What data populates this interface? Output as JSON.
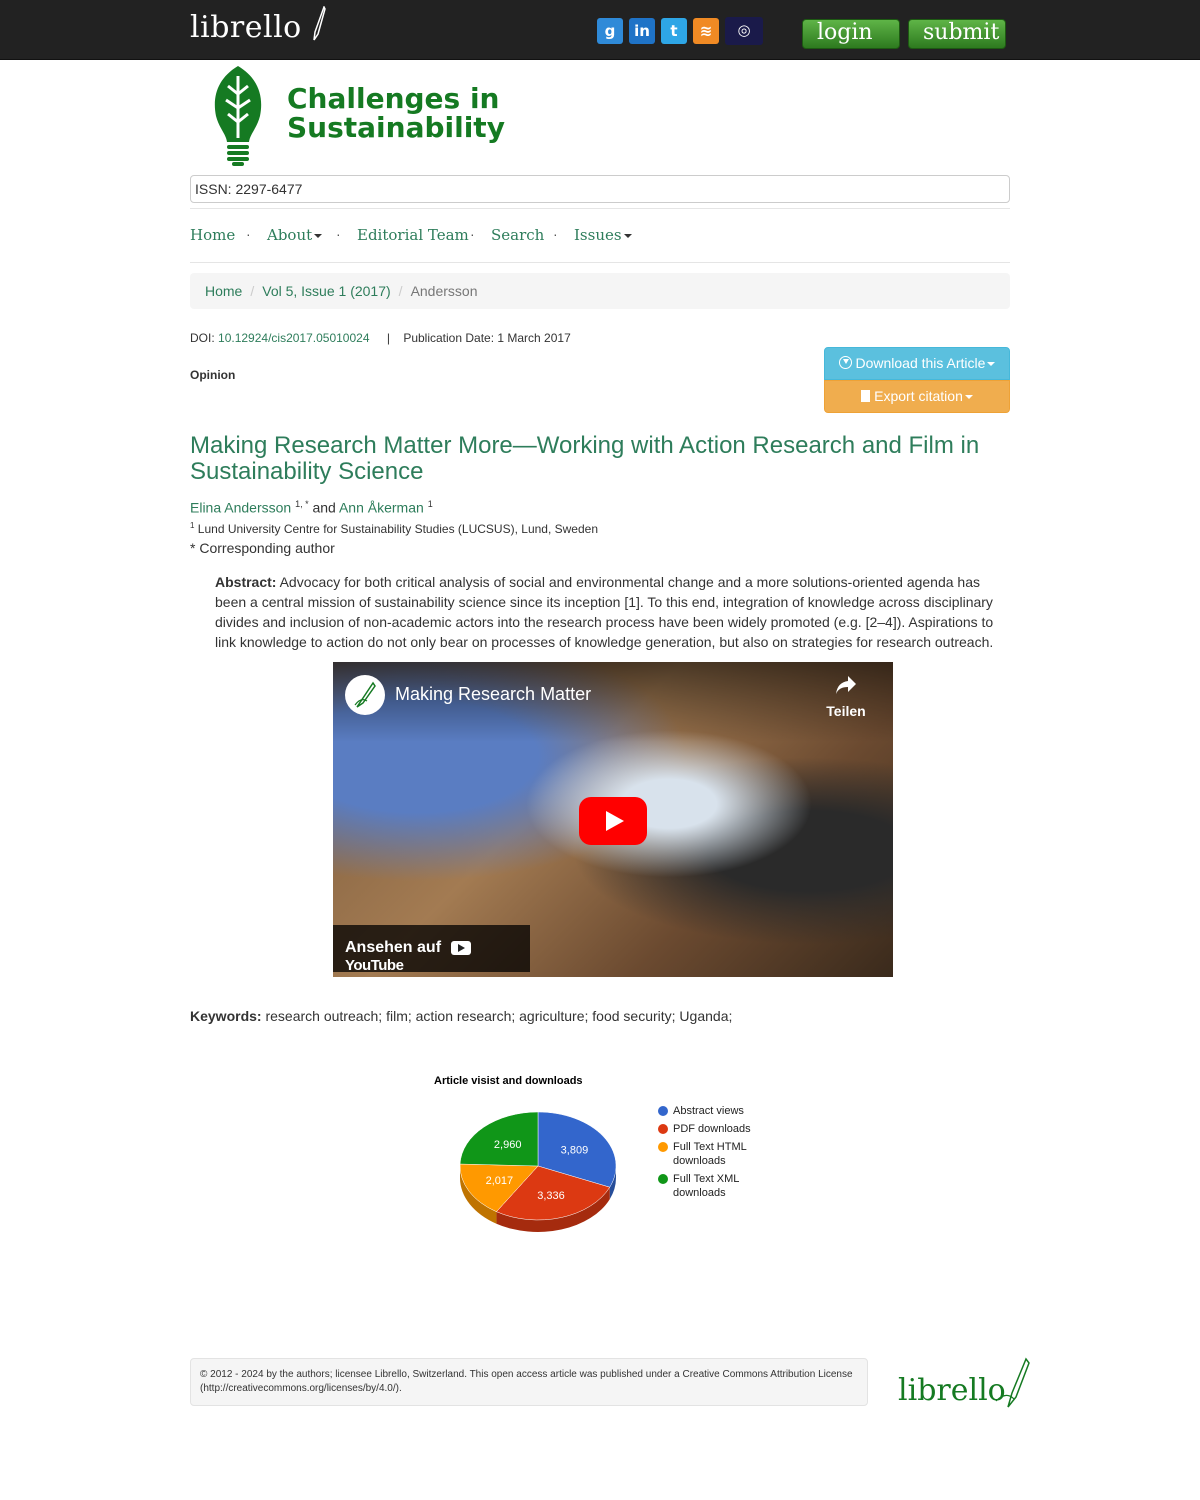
{
  "topbar": {
    "brand": "librello",
    "login_label": "login",
    "submit_label": "submit",
    "social": [
      {
        "name": "google",
        "glyph": "g",
        "color": "#2f8ad8"
      },
      {
        "name": "linkedin",
        "glyph": "in",
        "color": "#1f73c7"
      },
      {
        "name": "twitter",
        "glyph": "t",
        "color": "#2ea6e6"
      },
      {
        "name": "rss",
        "glyph": "≋",
        "color": "#f08a24"
      },
      {
        "name": "archive",
        "glyph": "◎",
        "color": "#1a1a4a"
      }
    ]
  },
  "journal": {
    "title_line1": "Challenges in",
    "title_line2": "Sustainability",
    "issn": "ISSN: 2297-6477"
  },
  "nav": {
    "home": "Home",
    "about": "About",
    "editorial": "Editorial Team",
    "search": "Search",
    "issues": "Issues",
    "separator": "·"
  },
  "breadcrumb": {
    "home": "Home",
    "issue": "Vol 5, Issue 1 (2017)",
    "current": "Andersson",
    "separator": "/"
  },
  "article": {
    "doi_label": "DOI:",
    "doi": "10.12924/cis2017.05010024",
    "divider": "|",
    "pub_date": "Publication Date: 1 March 2017",
    "type": "Opinion",
    "download_label": "Download this Article",
    "export_label": "Export citation",
    "title": "Making Research Matter More—Working with Action Research and Film in Sustainability Science",
    "author1": "Elina Andersson",
    "author1_sup": "1, *",
    "and": " and ",
    "author2": "Ann Åkerman",
    "author2_sup": "1",
    "affiliation_sup": "1",
    "affiliation": "Lund University Centre for Sustainability Studies (LUCSUS), Lund, Sweden",
    "corr_mark": "*",
    "corr_text": "Corresponding author",
    "abstract_label": "Abstract:",
    "abstract": "Advocacy for both critical analysis of social and environmental change and a more solutions-oriented agenda has been a central mission of sustainability science since its inception [1]. To this end, integration of knowledge across disciplinary divides and inclusion of non-academic actors into the research process have been widely promoted (e.g. [2–4]). Aspirations to link knowledge to action do not only bear on processes of knowledge generation, but also on strategies for research outreach.",
    "keywords_label": "Keywords:",
    "keywords": "research outreach; film; action research; agriculture; food security; Uganda;"
  },
  "video": {
    "title": "Making Research Matter",
    "share_label": "Teilen",
    "watch_label": "Ansehen auf",
    "yt_brand": "YouTube"
  },
  "chart_data": {
    "type": "pie",
    "title": "Article visist and downloads",
    "categories": [
      "Abstract views",
      "PDF downloads",
      "Full Text HTML downloads",
      "Full Text XML downloads"
    ],
    "values": [
      3809,
      3336,
      2017,
      2960
    ],
    "labels": [
      "3,809",
      "3,336",
      "2,017",
      "2,960"
    ],
    "colors": [
      "#3366cc",
      "#dc3912",
      "#ff9900",
      "#109618"
    ],
    "legend": "right",
    "three_d": true
  },
  "footer": {
    "copyright_symbol": "©",
    "text": "2012 - 2024 by the authors; licensee Librello, Switzerland. This open access article was published under a Creative Commons Attribution License (http://creativecommons.org/licenses/by/4.0/).",
    "brand": "librello"
  }
}
